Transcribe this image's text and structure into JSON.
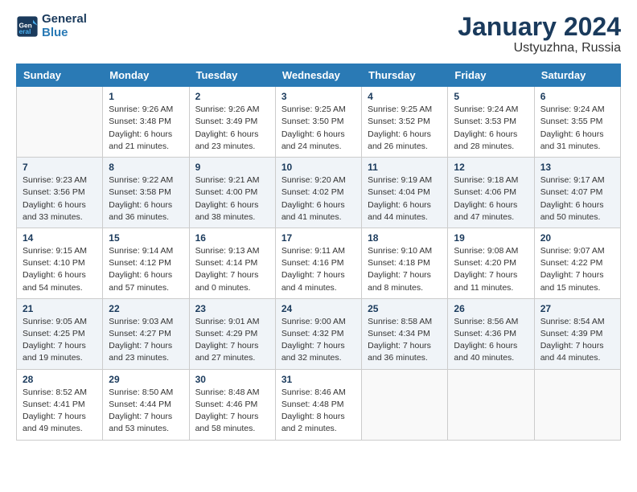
{
  "logo": {
    "line1": "General",
    "line2": "Blue"
  },
  "title": "January 2024",
  "subtitle": "Ustyuzhna, Russia",
  "days_of_week": [
    "Sunday",
    "Monday",
    "Tuesday",
    "Wednesday",
    "Thursday",
    "Friday",
    "Saturday"
  ],
  "weeks": [
    [
      {
        "num": "",
        "info": ""
      },
      {
        "num": "1",
        "info": "Sunrise: 9:26 AM\nSunset: 3:48 PM\nDaylight: 6 hours\nand 21 minutes."
      },
      {
        "num": "2",
        "info": "Sunrise: 9:26 AM\nSunset: 3:49 PM\nDaylight: 6 hours\nand 23 minutes."
      },
      {
        "num": "3",
        "info": "Sunrise: 9:25 AM\nSunset: 3:50 PM\nDaylight: 6 hours\nand 24 minutes."
      },
      {
        "num": "4",
        "info": "Sunrise: 9:25 AM\nSunset: 3:52 PM\nDaylight: 6 hours\nand 26 minutes."
      },
      {
        "num": "5",
        "info": "Sunrise: 9:24 AM\nSunset: 3:53 PM\nDaylight: 6 hours\nand 28 minutes."
      },
      {
        "num": "6",
        "info": "Sunrise: 9:24 AM\nSunset: 3:55 PM\nDaylight: 6 hours\nand 31 minutes."
      }
    ],
    [
      {
        "num": "7",
        "info": "Sunrise: 9:23 AM\nSunset: 3:56 PM\nDaylight: 6 hours\nand 33 minutes."
      },
      {
        "num": "8",
        "info": "Sunrise: 9:22 AM\nSunset: 3:58 PM\nDaylight: 6 hours\nand 36 minutes."
      },
      {
        "num": "9",
        "info": "Sunrise: 9:21 AM\nSunset: 4:00 PM\nDaylight: 6 hours\nand 38 minutes."
      },
      {
        "num": "10",
        "info": "Sunrise: 9:20 AM\nSunset: 4:02 PM\nDaylight: 6 hours\nand 41 minutes."
      },
      {
        "num": "11",
        "info": "Sunrise: 9:19 AM\nSunset: 4:04 PM\nDaylight: 6 hours\nand 44 minutes."
      },
      {
        "num": "12",
        "info": "Sunrise: 9:18 AM\nSunset: 4:06 PM\nDaylight: 6 hours\nand 47 minutes."
      },
      {
        "num": "13",
        "info": "Sunrise: 9:17 AM\nSunset: 4:07 PM\nDaylight: 6 hours\nand 50 minutes."
      }
    ],
    [
      {
        "num": "14",
        "info": "Sunrise: 9:15 AM\nSunset: 4:10 PM\nDaylight: 6 hours\nand 54 minutes."
      },
      {
        "num": "15",
        "info": "Sunrise: 9:14 AM\nSunset: 4:12 PM\nDaylight: 6 hours\nand 57 minutes."
      },
      {
        "num": "16",
        "info": "Sunrise: 9:13 AM\nSunset: 4:14 PM\nDaylight: 7 hours\nand 0 minutes."
      },
      {
        "num": "17",
        "info": "Sunrise: 9:11 AM\nSunset: 4:16 PM\nDaylight: 7 hours\nand 4 minutes."
      },
      {
        "num": "18",
        "info": "Sunrise: 9:10 AM\nSunset: 4:18 PM\nDaylight: 7 hours\nand 8 minutes."
      },
      {
        "num": "19",
        "info": "Sunrise: 9:08 AM\nSunset: 4:20 PM\nDaylight: 7 hours\nand 11 minutes."
      },
      {
        "num": "20",
        "info": "Sunrise: 9:07 AM\nSunset: 4:22 PM\nDaylight: 7 hours\nand 15 minutes."
      }
    ],
    [
      {
        "num": "21",
        "info": "Sunrise: 9:05 AM\nSunset: 4:25 PM\nDaylight: 7 hours\nand 19 minutes."
      },
      {
        "num": "22",
        "info": "Sunrise: 9:03 AM\nSunset: 4:27 PM\nDaylight: 7 hours\nand 23 minutes."
      },
      {
        "num": "23",
        "info": "Sunrise: 9:01 AM\nSunset: 4:29 PM\nDaylight: 7 hours\nand 27 minutes."
      },
      {
        "num": "24",
        "info": "Sunrise: 9:00 AM\nSunset: 4:32 PM\nDaylight: 7 hours\nand 32 minutes."
      },
      {
        "num": "25",
        "info": "Sunrise: 8:58 AM\nSunset: 4:34 PM\nDaylight: 7 hours\nand 36 minutes."
      },
      {
        "num": "26",
        "info": "Sunrise: 8:56 AM\nSunset: 4:36 PM\nDaylight: 6 hours\nand 40 minutes."
      },
      {
        "num": "27",
        "info": "Sunrise: 8:54 AM\nSunset: 4:39 PM\nDaylight: 7 hours\nand 44 minutes."
      }
    ],
    [
      {
        "num": "28",
        "info": "Sunrise: 8:52 AM\nSunset: 4:41 PM\nDaylight: 7 hours\nand 49 minutes."
      },
      {
        "num": "29",
        "info": "Sunrise: 8:50 AM\nSunset: 4:44 PM\nDaylight: 7 hours\nand 53 minutes."
      },
      {
        "num": "30",
        "info": "Sunrise: 8:48 AM\nSunset: 4:46 PM\nDaylight: 7 hours\nand 58 minutes."
      },
      {
        "num": "31",
        "info": "Sunrise: 8:46 AM\nSunset: 4:48 PM\nDaylight: 8 hours\nand 2 minutes."
      },
      {
        "num": "",
        "info": ""
      },
      {
        "num": "",
        "info": ""
      },
      {
        "num": "",
        "info": ""
      }
    ]
  ]
}
